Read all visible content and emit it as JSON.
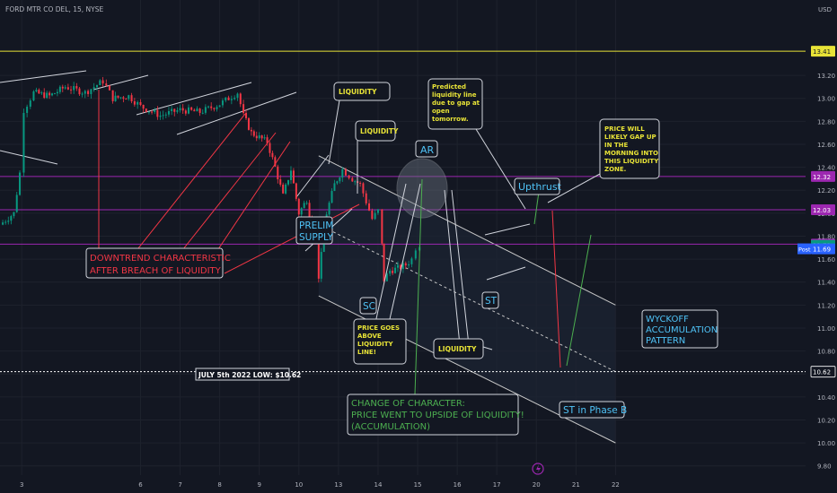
{
  "header": {
    "symbol_title": "FORD MTR CO DEL, 15, NYSE",
    "currency": "USD"
  },
  "chart_data": {
    "type": "candlestick",
    "title": "FORD MTR CO DEL, 15, NYSE",
    "ylabel": "USD",
    "ylim": [
      9.72,
      13.7
    ],
    "xlim": [
      2.45,
      22.8
    ],
    "grid": true,
    "y_ticks": [
      9.8,
      10.0,
      10.2,
      10.4,
      10.6,
      10.8,
      11.0,
      11.2,
      11.4,
      11.6,
      11.8,
      12.0,
      12.2,
      12.4,
      12.6,
      12.8,
      13.0,
      13.2
    ],
    "x_ticks": [
      {
        "label": "3",
        "x": 3
      },
      {
        "label": "6",
        "x": 6
      },
      {
        "label": "7",
        "x": 7
      },
      {
        "label": "8",
        "x": 8
      },
      {
        "label": "9",
        "x": 9
      },
      {
        "label": "10",
        "x": 10
      },
      {
        "label": "13",
        "x": 11
      },
      {
        "label": "14",
        "x": 12
      },
      {
        "label": "15",
        "x": 13
      },
      {
        "label": "16",
        "x": 14
      },
      {
        "label": "17",
        "x": 15
      },
      {
        "label": "20",
        "x": 16
      },
      {
        "label": "21",
        "x": 17
      },
      {
        "label": "22",
        "x": 18
      }
    ],
    "price_path": [
      [
        2.45,
        11.9
      ],
      [
        2.8,
        12.0
      ],
      [
        2.95,
        12.35
      ],
      [
        3.05,
        12.9
      ],
      [
        3.3,
        13.05
      ],
      [
        3.7,
        13.02
      ],
      [
        4.1,
        13.1
      ],
      [
        4.6,
        13.05
      ],
      [
        5.05,
        13.15
      ],
      [
        5.3,
        13.0
      ],
      [
        5.7,
        13.02
      ],
      [
        6.0,
        12.93
      ],
      [
        6.5,
        12.85
      ],
      [
        7.0,
        12.9
      ],
      [
        7.5,
        12.88
      ],
      [
        8.0,
        12.95
      ],
      [
        8.45,
        13.05
      ],
      [
        8.6,
        12.85
      ],
      [
        8.8,
        12.7
      ],
      [
        9.2,
        12.62
      ],
      [
        9.4,
        12.4
      ],
      [
        9.6,
        12.15
      ],
      [
        9.8,
        12.38
      ],
      [
        10.0,
        12.0
      ],
      [
        10.2,
        12.12
      ],
      [
        10.4,
        11.75
      ],
      [
        10.5,
        11.45
      ],
      [
        10.7,
        12.0
      ],
      [
        10.9,
        12.25
      ],
      [
        11.1,
        12.38
      ],
      [
        11.35,
        12.3
      ],
      [
        11.55,
        12.25
      ],
      [
        11.7,
        12.1
      ],
      [
        11.85,
        11.95
      ],
      [
        12.0,
        12.02
      ],
      [
        12.1,
        11.72
      ],
      [
        12.15,
        11.42
      ],
      [
        12.3,
        11.5
      ],
      [
        12.5,
        11.52
      ],
      [
        12.7,
        11.55
      ],
      [
        12.85,
        11.6
      ],
      [
        12.95,
        11.7
      ],
      [
        13.05,
        11.73
      ]
    ],
    "horizontal_levels": [
      {
        "value": 13.41,
        "label": "13.41",
        "color": "#e8e337",
        "style": "solid"
      },
      {
        "value": 12.32,
        "label": "12.32",
        "color": "#9c27b0",
        "style": "solid"
      },
      {
        "value": 12.03,
        "label": "12.03",
        "color": "#9c27b0",
        "style": "solid"
      },
      {
        "value": 11.73,
        "label": "11.73",
        "color": "#9c27b0",
        "style": "solid"
      },
      {
        "value": 10.62,
        "label": "10.62",
        "color": "#ffffff",
        "style": "dotted"
      }
    ],
    "price_badges": [
      {
        "value": 11.72,
        "label": "11.72",
        "color": "#089981"
      },
      {
        "value": 11.69,
        "label": "11.69",
        "color": "#2962ff",
        "tag": "Post"
      }
    ],
    "channel": {
      "upper": [
        [
          10.5,
          12.5
        ],
        [
          18.0,
          11.2
        ]
      ],
      "lower": [
        [
          10.5,
          11.28
        ],
        [
          18.0,
          10.0
        ]
      ],
      "mid": [
        [
          10.5,
          11.9
        ],
        [
          18.0,
          10.62
        ]
      ]
    },
    "annotations": [
      {
        "text": "LIQUIDITY",
        "x": 10.85,
        "y": 12.98,
        "color": "#e8e337"
      },
      {
        "text": "LIQUIDITY",
        "x": 11.4,
        "y": 12.65,
        "color": "#e8e337"
      },
      {
        "text": "AR",
        "x": 11.95,
        "y": 12.5,
        "color": "#4fc3f7"
      },
      {
        "text": "Predicted liquidity line due to gap at open tomorrow.",
        "x": 13.0,
        "y": 12.9,
        "color": "#e8e337"
      },
      {
        "text": "PRICE WILL LIKELY GAP UP IN THE MORNING INTO THIS LIQUIDITY ZONE.",
        "x": 15.55,
        "y": 12.4,
        "color": "#e8e337"
      },
      {
        "text": "Upthrust",
        "x": 14.0,
        "y": 12.0,
        "color": "#4fc3f7"
      },
      {
        "text": "PRELIM SUPPLY",
        "x": 10.1,
        "y": 11.75,
        "color": "#4fc3f7"
      },
      {
        "text": "DOWNTREND CHARACTERISTIC AFTER BREACH OF LIQUIDITY",
        "x": 4.8,
        "y": 11.45,
        "color": "#f23645"
      },
      {
        "text": "SC",
        "x": 11.0,
        "y": 11.2,
        "color": "#4fc3f7"
      },
      {
        "text": "ST",
        "x": 13.1,
        "y": 11.22,
        "color": "#4fc3f7"
      },
      {
        "text": "PRICE GOES ABOVE LIQUIDITY LINE!",
        "x": 11.0,
        "y": 10.85,
        "color": "#e8e337"
      },
      {
        "text": "LIQUIDITY",
        "x": 12.9,
        "y": 10.75,
        "color": "#e8e337"
      },
      {
        "text": "WYCKOFF ACCUMULATION PATTERN",
        "x": 16.65,
        "y": 10.95,
        "color": "#4fc3f7"
      },
      {
        "text": "JULY 5th 2022 LOW: $10.62",
        "x": 5.0,
        "y": 10.55,
        "color": "#ffffff"
      },
      {
        "text": "CHANGE OF CHARACTER: PRICE WENT TO UPSIDE OF LIQUIDITY! (ACCUMULATION)",
        "x": 12.6,
        "y": 10.3,
        "color": "#4caf50"
      },
      {
        "text": "ST in Phase B",
        "x": 15.0,
        "y": 10.25,
        "color": "#4fc3f7"
      }
    ]
  },
  "labels": {
    "liquidity_1": "LIQUIDITY",
    "liquidity_2": "LIQUIDITY",
    "liquidity_3": "LIQUIDITY",
    "ar": "AR",
    "predicted": [
      "Predicted",
      "liquidity line",
      "due to gap at",
      "open",
      "tomorrow."
    ],
    "gap_note": [
      "PRICE WILL",
      "LIKELY GAP UP",
      "IN THE",
      "MORNING INTO",
      "THIS LIQUIDITY",
      "ZONE."
    ],
    "upthrust": "Upthrust",
    "prelim": [
      "PRELIM",
      "SUPPLY"
    ],
    "downtrend": [
      "DOWNTREND CHARACTERISTIC",
      "AFTER BREACH OF LIQUIDITY"
    ],
    "sc": "SC",
    "st": "ST",
    "price_goes": [
      "PRICE GOES",
      "ABOVE",
      "LIQUIDITY",
      "LINE!"
    ],
    "wyckoff": [
      "WYCKOFF",
      "ACCUMULATION",
      "PATTERN"
    ],
    "july_low": "JULY 5th 2022 LOW: $10.62",
    "choch": [
      "CHANGE OF CHARACTER:",
      "PRICE WENT TO UPSIDE OF LIQUIDITY!",
      "(ACCUMULATION)"
    ],
    "st_phase_b": "ST in Phase B",
    "post_tag": "Post"
  },
  "colors": {
    "background": "#131722",
    "grid": "#1e222d",
    "candle_up": "#089981",
    "candle_down": "#f23645",
    "accent_blue": "#4fc3f7",
    "annotation_yellow": "#e8e337",
    "choch_green": "#4caf50",
    "channel_fill": "#1c2433"
  }
}
